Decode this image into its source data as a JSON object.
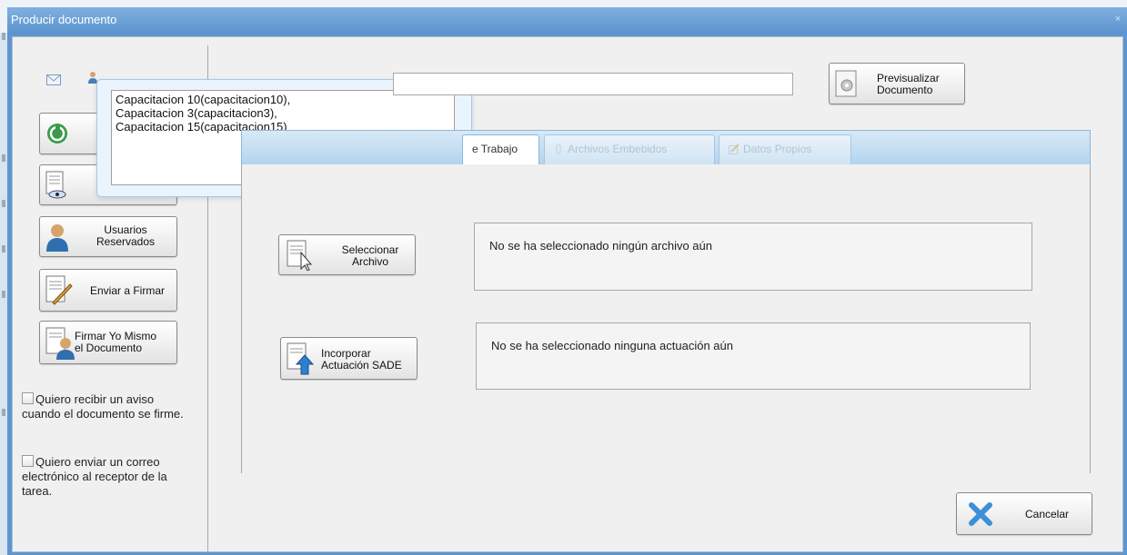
{
  "window": {
    "title": "Producir documento",
    "close_glyph": "×"
  },
  "popup": {
    "text": "Capacitacion 10(capacitacion10),\nCapacitacion 3(capacitacion3),\nCapacitacion 15(capacitacion15)"
  },
  "sidebar": {
    "usuarios_reservados": {
      "line1": "Usuarios",
      "line2": "Reservados"
    },
    "enviar_firmar": "Enviar a Firmar",
    "firmar_yo_mismo": {
      "line1": "Firmar Yo Mismo",
      "line2": "el Documento"
    },
    "check_aviso": "Quiero recibir un aviso cuando el documento se firme.",
    "check_correo": "Quiero enviar un correo electrónico al receptor de la tarea."
  },
  "header": {
    "previsualizar": {
      "line1": "Previsualizar",
      "line2": "Documento"
    }
  },
  "tabs": [
    {
      "label": "e Trabajo",
      "active": true
    },
    {
      "label": "Archivos Embebidos",
      "active": false
    },
    {
      "label": "Datos Propios",
      "active": false
    }
  ],
  "main": {
    "seleccionar": {
      "line1": "Seleccionar",
      "line2": "Archivo"
    },
    "archivo_status": "No se ha seleccionado ningún archivo aún",
    "incorporar": {
      "line1": "Incorporar",
      "line2": "Actuación SADE"
    },
    "actuacion_status": "No se ha seleccionado ninguna actuación aún"
  },
  "footer": {
    "cancelar": "Cancelar"
  },
  "colors": {
    "titlebar": "#5d95cf",
    "tabbar": "#b3d4ee",
    "cancel_icon": "#3d8fd6"
  }
}
